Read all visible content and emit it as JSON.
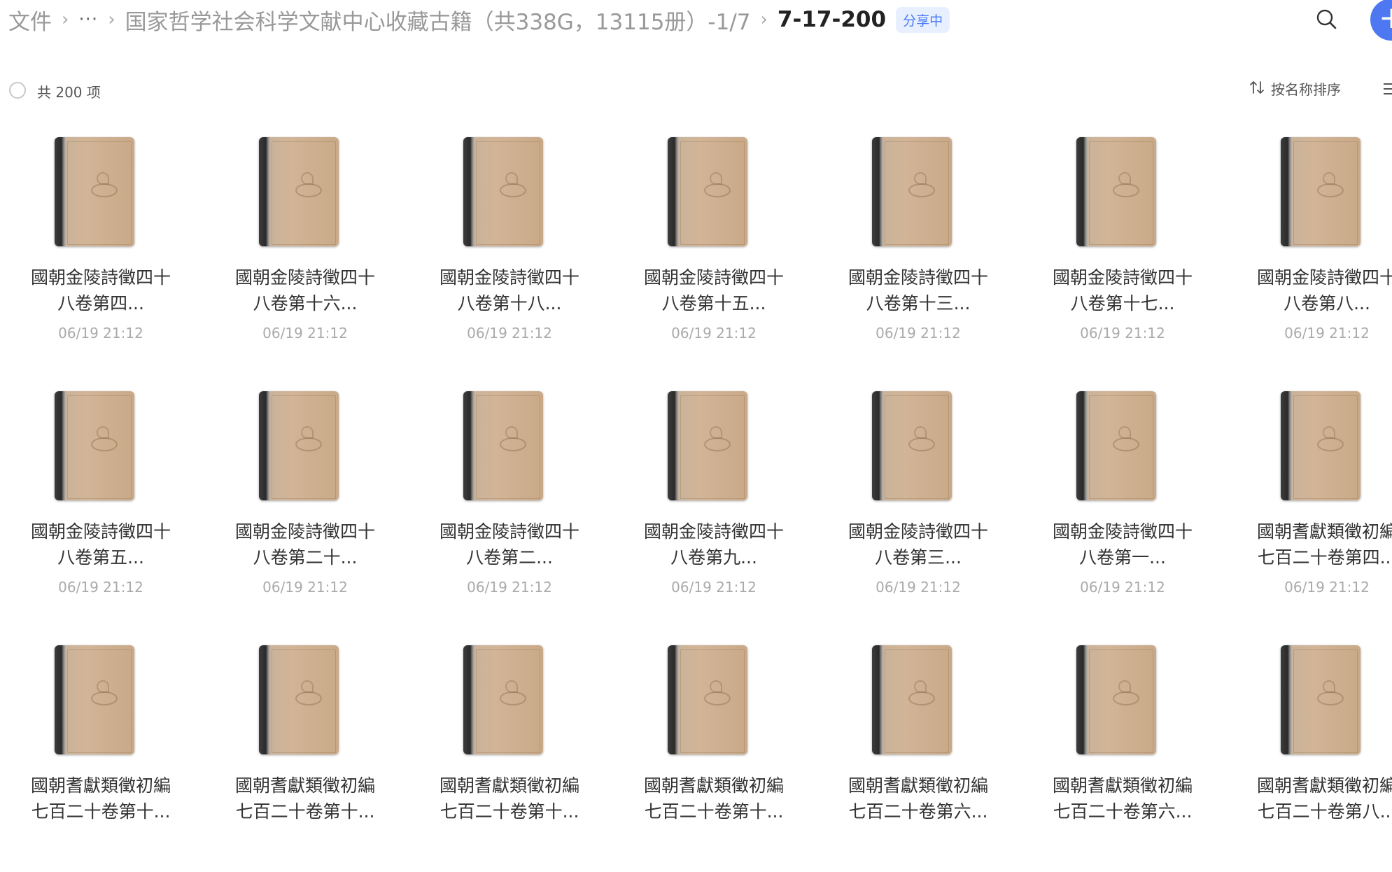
{
  "breadcrumb": {
    "root": "文件",
    "more": "···",
    "parent": "国家哲学社会科学文献中心收藏古籍（共338G，13115册）-1/7",
    "current": "7-17-200",
    "badge": "分享中"
  },
  "toolbar": {
    "count_label": "共 200 项",
    "sort_label": "按名称排序"
  },
  "icons": {
    "search": "search-icon",
    "add": "plus-icon",
    "sort": "sort-arrows-icon",
    "view": "list-view-icon",
    "file": "book-thumbnail-icon"
  },
  "colors": {
    "accent": "#4d78f2",
    "badge_bg": "#e8efff",
    "badge_text": "#4a7bf7"
  },
  "files": [
    {
      "line1": "國朝金陵詩徵四十",
      "line2": "八卷第四...",
      "time": "06/19 21:12"
    },
    {
      "line1": "國朝金陵詩徵四十",
      "line2": "八卷第十六...",
      "time": "06/19 21:12"
    },
    {
      "line1": "國朝金陵詩徵四十",
      "line2": "八卷第十八...",
      "time": "06/19 21:12"
    },
    {
      "line1": "國朝金陵詩徵四十",
      "line2": "八卷第十五...",
      "time": "06/19 21:12"
    },
    {
      "line1": "國朝金陵詩徵四十",
      "line2": "八卷第十三...",
      "time": "06/19 21:12"
    },
    {
      "line1": "國朝金陵詩徵四十",
      "line2": "八卷第十七...",
      "time": "06/19 21:12"
    },
    {
      "line1": "國朝金陵詩徵四十",
      "line2": "八卷第八...",
      "time": "06/19 21:12"
    },
    {
      "line1": "國朝金陵詩徵四十",
      "line2": "八卷第五...",
      "time": "06/19 21:12"
    },
    {
      "line1": "國朝金陵詩徵四十",
      "line2": "八卷第二十...",
      "time": "06/19 21:12"
    },
    {
      "line1": "國朝金陵詩徵四十",
      "line2": "八卷第二...",
      "time": "06/19 21:12"
    },
    {
      "line1": "國朝金陵詩徵四十",
      "line2": "八卷第九...",
      "time": "06/19 21:12"
    },
    {
      "line1": "國朝金陵詩徵四十",
      "line2": "八卷第三...",
      "time": "06/19 21:12"
    },
    {
      "line1": "國朝金陵詩徵四十",
      "line2": "八卷第一...",
      "time": "06/19 21:12"
    },
    {
      "line1": "國朝耆獻類徵初編",
      "line2": "七百二十卷第四...",
      "time": "06/19 21:12"
    },
    {
      "line1": "國朝耆獻類徵初編",
      "line2": "七百二十卷第十...",
      "time": ""
    },
    {
      "line1": "國朝耆獻類徵初編",
      "line2": "七百二十卷第十...",
      "time": ""
    },
    {
      "line1": "國朝耆獻類徵初編",
      "line2": "七百二十卷第十...",
      "time": ""
    },
    {
      "line1": "國朝耆獻類徵初編",
      "line2": "七百二十卷第十...",
      "time": ""
    },
    {
      "line1": "國朝耆獻類徵初編",
      "line2": "七百二十卷第六...",
      "time": ""
    },
    {
      "line1": "國朝耆獻類徵初編",
      "line2": "七百二十卷第六...",
      "time": ""
    },
    {
      "line1": "國朝耆獻類徵初編",
      "line2": "七百二十卷第八...",
      "time": ""
    }
  ]
}
